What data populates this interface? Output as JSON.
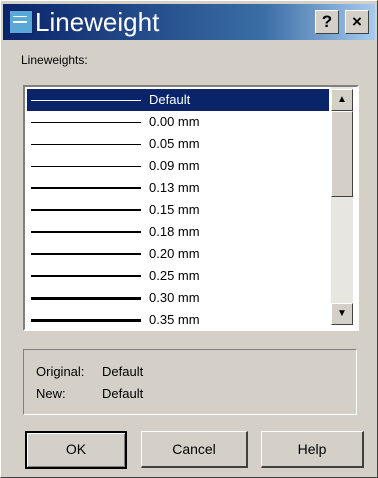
{
  "window": {
    "title": "Lineweight",
    "help_label": "?",
    "close_label": "×"
  },
  "list": {
    "label": "Lineweights:",
    "items": [
      {
        "label": "Default",
        "selected": true
      },
      {
        "label": "0.00 mm"
      },
      {
        "label": "0.05 mm"
      },
      {
        "label": "0.09 mm"
      },
      {
        "label": "0.13 mm"
      },
      {
        "label": "0.15 mm"
      },
      {
        "label": "0.18 mm"
      },
      {
        "label": "0.20 mm"
      },
      {
        "label": "0.25 mm"
      },
      {
        "label": "0.30 mm"
      },
      {
        "label": "0.35 mm"
      }
    ],
    "scroll_up": "▲",
    "scroll_down": "▼"
  },
  "info": {
    "original_label": "Original:",
    "original_value": "Default",
    "new_label": "New:",
    "new_value": "Default"
  },
  "buttons": {
    "ok": "OK",
    "cancel": "Cancel",
    "help": "Help"
  },
  "colors": {
    "selection": "#0a246a",
    "face": "#d4d0c8"
  }
}
